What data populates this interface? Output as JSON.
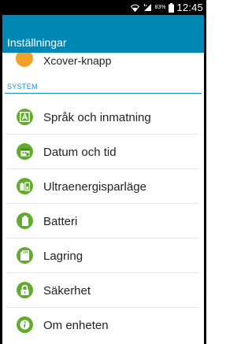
{
  "status_bar": {
    "battery_percent": "83%",
    "time": "12:45",
    "icons": [
      "wifi-icon",
      "signal-icon",
      "battery-icon"
    ]
  },
  "header": {
    "title": "Inställningar",
    "background_color": "#0088b5"
  },
  "list": {
    "partial_item": {
      "label": "Xcover-knapp",
      "icon": "xcover-key-icon",
      "icon_color": "#f2a02a"
    },
    "section_title": "SYSTEM",
    "icon_color": "#62ac2c",
    "items": [
      {
        "label": "Språk och inmatning",
        "icon": "language-icon"
      },
      {
        "label": "Datum och tid",
        "icon": "calendar-icon"
      },
      {
        "label": "Ultraenergisparläge",
        "icon": "power-saving-icon"
      },
      {
        "label": "Batteri",
        "icon": "battery-icon"
      },
      {
        "label": "Lagring",
        "icon": "storage-icon"
      },
      {
        "label": "Säkerhet",
        "icon": "lock-icon"
      },
      {
        "label": "Om enheten",
        "icon": "info-icon"
      }
    ]
  }
}
